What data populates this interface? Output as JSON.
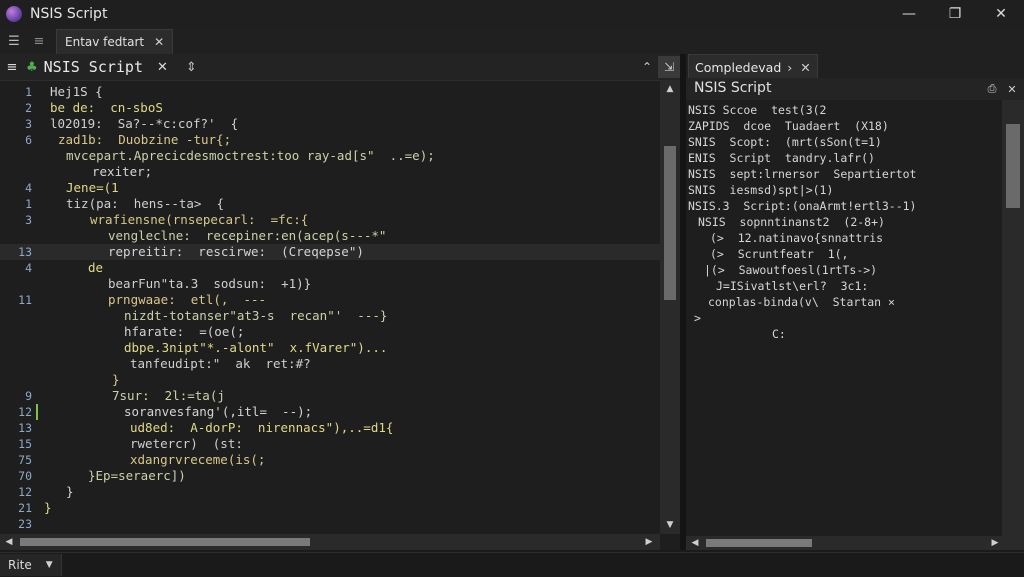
{
  "app": {
    "title": "NSIS Script"
  },
  "window_controls": {
    "minimize": "—",
    "maximize": "❐",
    "close": "✕"
  },
  "doc_tab": {
    "label": "Entav fedtart",
    "close": "✕"
  },
  "left_pane": {
    "title": "NSIS Script",
    "close": "✕",
    "lines": [
      {
        "ln": "1",
        "indent": 50,
        "text": "Hej1S {"
      },
      {
        "ln": "2",
        "indent": 50,
        "text": "be de:  cn-sboS"
      },
      {
        "ln": "3",
        "indent": 50,
        "text": "l02019:  Sa?--*c:cof?'  {"
      },
      {
        "ln": "6",
        "indent": 58,
        "text": "zad1b:  Duobzine -tur{;"
      },
      {
        "ln": "",
        "indent": 66,
        "text": "mvcepart.Aprecicdesmoctrest:too ray-ad[s\"  ..=e);"
      },
      {
        "ln": "",
        "indent": 92,
        "text": "rexiter;"
      },
      {
        "ln": "4",
        "indent": 66,
        "text": "Jene=(1"
      },
      {
        "ln": "1",
        "indent": 66,
        "text": "tiz(pa:  hens--ta>  {"
      },
      {
        "ln": "3",
        "indent": 90,
        "text": "wrafiensne(rnsepecarl:  =fc:{"
      },
      {
        "ln": "",
        "indent": 108,
        "text": "vengleclne:  recepiner:en(acep(s---*\""
      },
      {
        "ln": "13",
        "indent": 108,
        "text": "repreitir:  rescirwe:  (Creqepse\")"
      },
      {
        "ln": "4",
        "indent": 88,
        "text": "de"
      },
      {
        "ln": "",
        "indent": 108,
        "text": "bearFun\"ta.3  sodsun:  +1)}"
      },
      {
        "ln": "11",
        "indent": 108,
        "text": "prngwaae:  etl(,  ---"
      },
      {
        "ln": "",
        "indent": 124,
        "text": "nizdt-totanser\"at3-s  recan\"'  ---}"
      },
      {
        "ln": "",
        "indent": 124,
        "text": "hfarate:  =(oe(;"
      },
      {
        "ln": "",
        "indent": 124,
        "text": "dbpe.3nipt\"*.-alont\"  x.fVarer\")..."
      },
      {
        "ln": "",
        "indent": 130,
        "text": "tanfeudipt:\"  ak  ret:#?"
      },
      {
        "ln": "",
        "indent": 112,
        "text": "}"
      },
      {
        "ln": "9",
        "indent": 112,
        "text": "7sur:  2l:=ta(j"
      },
      {
        "ln": "12",
        "indent": 124,
        "text": "soranvesfang'(,itl=  --);"
      },
      {
        "ln": "13",
        "indent": 130,
        "text": "ud8ed:  A-dorP:  nirennacs\"),..=d1{"
      },
      {
        "ln": "15",
        "indent": 130,
        "text": "rwetercr)  (st:"
      },
      {
        "ln": "75",
        "indent": 130,
        "text": "xdangrvreceme(is(;"
      },
      {
        "ln": "70",
        "indent": 88,
        "text": "}Ep=seraerc])"
      },
      {
        "ln": "12",
        "indent": 66,
        "text": "}"
      },
      {
        "ln": "21",
        "indent": 44,
        "text": "}"
      },
      {
        "ln": "23",
        "indent": 44,
        "text": ""
      }
    ]
  },
  "right_pane": {
    "tab_label": "Compledevad",
    "tab_chevron": "›",
    "tab_close": "✕",
    "title": "NSIS Script",
    "lines": [
      {
        "indent": 2,
        "text": "NSIS Sccoe  test(3(2"
      },
      {
        "indent": 2,
        "text": "ZAPIDS  dcoe  Tuadaert  (X18)"
      },
      {
        "indent": 2,
        "text": "SNIS  Scopt:  (mrt(sSon(t=1)"
      },
      {
        "indent": 2,
        "text": "ENIS  Script  tandry.lafr()"
      },
      {
        "indent": 2,
        "text": "NSIS  sept:lrnersor  Separtiertot"
      },
      {
        "indent": 2,
        "text": "SNIS  iesmsd)spt|>(1)"
      },
      {
        "indent": 2,
        "text": "NSIS.3  Script:(onaArmt!ertl3--1)"
      },
      {
        "indent": 12,
        "text": "NSIS  sopnntinanst2  (2-8+)"
      },
      {
        "indent": 24,
        "text": "(>  12.natinavo{snnattris"
      },
      {
        "indent": 24,
        "text": "(>  Scruntfeatr  1(,"
      },
      {
        "indent": 18,
        "text": "|(>  Sawoutfoesl(1rtTs->)"
      },
      {
        "indent": 30,
        "text": "J=ISivatlst\\erl?  3c1:"
      },
      {
        "indent": 22,
        "text": "conplas-binda(v\\  Startan ×"
      },
      {
        "indent": 8,
        "text": ">"
      },
      {
        "indent": 86,
        "text": "C:"
      }
    ]
  },
  "status": {
    "label": "Rite"
  }
}
